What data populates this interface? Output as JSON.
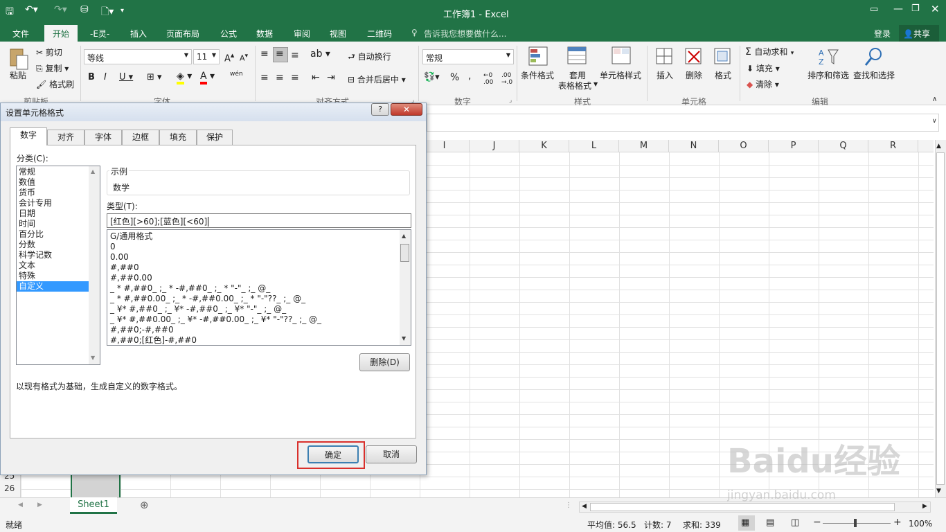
{
  "window": {
    "title": "工作簿1 - Excel"
  },
  "menu_tabs": [
    "文件",
    "开始",
    "插入",
    "页面布局",
    "公式",
    "数据",
    "审阅",
    "视图",
    "二维码"
  ],
  "menu_extra": "-E灵-",
  "tell_me": "告诉我您想要做什么...",
  "login": "登录",
  "share": "共享",
  "ribbon": {
    "paste": "粘贴",
    "cut": "剪切",
    "copy": "复制",
    "format_painter": "格式刷",
    "clipboard_group": "剪贴板",
    "font_name": "等线",
    "font_size": "11",
    "font_group": "字体",
    "wen": "wén",
    "wrap_text": "自动换行",
    "merge_center": "合并后居中",
    "align_group": "对齐方式",
    "number_format": "常规",
    "number_group": "数字",
    "cond_format": "条件格式",
    "table_format_1": "套用",
    "table_format_2": "表格格式",
    "cell_styles": "单元格样式",
    "styles_group": "样式",
    "insert": "插入",
    "delete": "删除",
    "format": "格式",
    "cells_group": "单元格",
    "autosum": "自动求和",
    "fill": "填充",
    "clear": "清除",
    "sort_filter": "排序和筛选",
    "find_select": "查找和选择",
    "edit_group": "编辑"
  },
  "columns": [
    "I",
    "J",
    "K",
    "L",
    "M",
    "N",
    "O",
    "P",
    "Q",
    "R"
  ],
  "rows_visible": [
    "25",
    "26"
  ],
  "dialog": {
    "title": "设置单元格格式",
    "help": "?",
    "tabs": [
      "数字",
      "对齐",
      "字体",
      "边框",
      "填充",
      "保护"
    ],
    "category_label": "分类(C):",
    "categories": [
      "常规",
      "数值",
      "货币",
      "会计专用",
      "日期",
      "时间",
      "百分比",
      "分数",
      "科学记数",
      "文本",
      "特殊",
      "自定义"
    ],
    "selected_category": "自定义",
    "sample_label": "示例",
    "sample_value": "数学",
    "type_label": "类型(T):",
    "type_value": "[红色][>60];[蓝色][<60]",
    "formats": [
      "G/通用格式",
      "0",
      "0.00",
      "#,##0",
      "#,##0.00",
      "_ * #,##0_ ;_ * -#,##0_ ;_ * \"-\"_ ;_ @_",
      "_ * #,##0.00_ ;_ * -#,##0.00_ ;_ * \"-\"??_ ;_ @_",
      "_ ¥* #,##0_ ;_ ¥* -#,##0_ ;_ ¥* \"-\"_ ;_ @_",
      "_ ¥* #,##0.00_ ;_ ¥* -#,##0.00_ ;_ ¥* \"-\"??_ ;_ @_",
      "#,##0;-#,##0",
      "#,##0;[红色]-#,##0"
    ],
    "delete_btn": "删除(D)",
    "description": "以现有格式为基础，生成自定义的数字格式。",
    "ok_btn": "确定",
    "cancel_btn": "取消",
    "highlight_color": "#d9302c"
  },
  "sheet_tab": "Sheet1",
  "status": {
    "ready": "就绪",
    "average": "平均值: 56.5",
    "count": "计数: 7",
    "sum": "求和: 339",
    "zoom": "100%"
  },
  "watermark": {
    "text1": "Baidu经验",
    "text2": "jingyan.baidu.com"
  },
  "colors": {
    "excel_green": "#217346"
  }
}
